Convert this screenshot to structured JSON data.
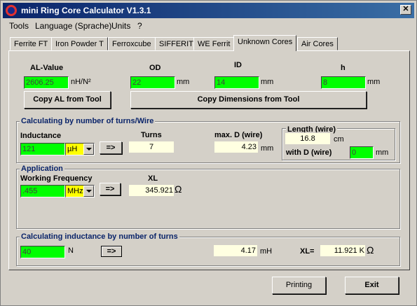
{
  "window": {
    "title": "mini Ring Core Calculator V1.3.1",
    "close_glyph": "✕"
  },
  "menu": [
    {
      "label": "Tools",
      "u": "T"
    },
    {
      "label": "Language (Sprache)",
      "u": "L"
    },
    {
      "label": "Units",
      "u": "U"
    },
    {
      "label": "?",
      "u": "?"
    }
  ],
  "tabs": [
    {
      "label": "Ferrite FT"
    },
    {
      "label": "Iron Powder T"
    },
    {
      "label": "Ferroxcube"
    },
    {
      "label": "SIFFERIT"
    },
    {
      "label": "WE Ferrit"
    },
    {
      "label": "Unknown Cores",
      "active": true
    },
    {
      "label": "Air Cores"
    }
  ],
  "core": {
    "al_label": "AL-Value",
    "al_value": "2606.25",
    "al_unit": "nH/N²",
    "od_label": "OD",
    "od_value": "22",
    "od_unit": "mm",
    "id_label": "ID",
    "id_value": "14",
    "id_unit": "mm",
    "h_label": "h",
    "h_value": "8",
    "h_unit": "mm",
    "copy_al_button": "Copy AL from Tool",
    "copy_dim_button": "Copy Dimensions from Tool"
  },
  "turns_group": {
    "title": "Calculating by number of turns/Wire",
    "inductance_label": "Inductance",
    "inductance_value": "121",
    "inductance_unit": "µH",
    "arrow_button": "=>",
    "turns_label": "Turns",
    "turns_value": "7",
    "maxd_label": "max. D (wire)",
    "maxd_value": "4.23",
    "maxd_unit": "mm",
    "length_title": "Length (wire)",
    "length_value": "16.8",
    "length_unit": "cm",
    "withd_label": "with D (wire)",
    "withd_value": "0",
    "withd_unit": "mm"
  },
  "app_group": {
    "title": "Application",
    "freq_label": "Working Frequency",
    "freq_value": ".455",
    "freq_unit": "MHz",
    "arrow_button": "=>",
    "xl_label": "XL",
    "xl_value": "345.921",
    "xl_unit": "Ω"
  },
  "ind_group": {
    "title": "Calculating inductance by number of turns",
    "turns_value": "40",
    "turns_unit": "N",
    "arrow_button": "=>",
    "ind_value": "4.17",
    "ind_unit": "mH",
    "xl_label": "XL=",
    "xl_value": "11.921 K",
    "xl_unit": "Ω"
  },
  "footer": {
    "print_button": "Printing",
    "exit_button": "Exit"
  }
}
